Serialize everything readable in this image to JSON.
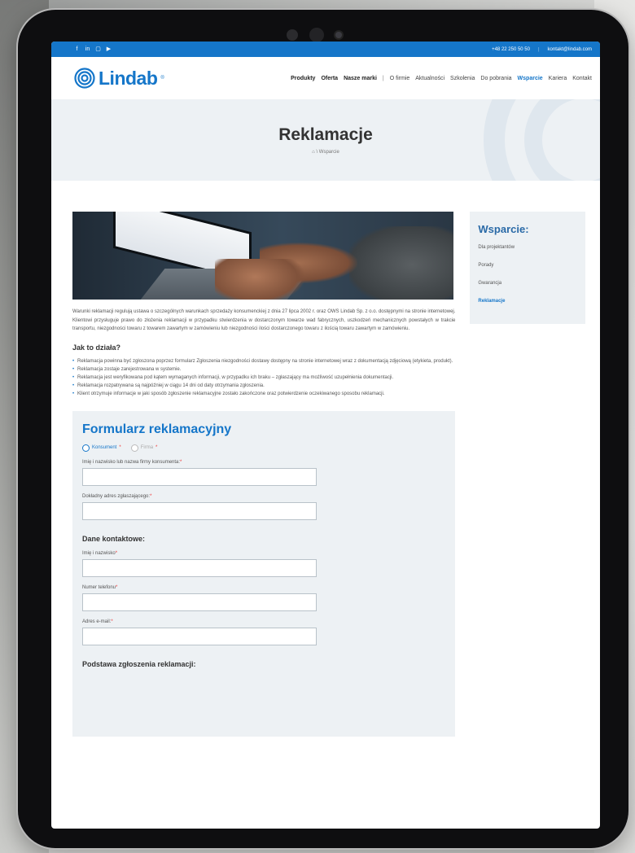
{
  "topbar": {
    "phone": "+48 22 250 50 50",
    "email": "kontakt@lindab.com",
    "social_icons": [
      "facebook-icon",
      "linkedin-icon",
      "instagram-icon",
      "youtube-icon"
    ]
  },
  "header": {
    "logo_text": "Lindab",
    "logo_reg": "®",
    "nav": [
      {
        "label": "Produkty",
        "style": "bold"
      },
      {
        "label": "Oferta",
        "style": "bold"
      },
      {
        "label": "Nasze marki",
        "style": "bold"
      },
      {
        "label": "|",
        "style": "pipe"
      },
      {
        "label": "O firmie",
        "style": "normal"
      },
      {
        "label": "Aktualności",
        "style": "normal"
      },
      {
        "label": "Szkolenia",
        "style": "normal"
      },
      {
        "label": "Do pobrania",
        "style": "normal"
      },
      {
        "label": "Wsparcie",
        "style": "active"
      },
      {
        "label": "Kariera",
        "style": "normal"
      },
      {
        "label": "Kontakt",
        "style": "normal"
      }
    ]
  },
  "hero": {
    "title": "Reklamacje",
    "breadcrumb": "⌂ \\ Wsparcie"
  },
  "main": {
    "intro": "Warunki reklamacji regulują ustawa o szczególnych warunkach sprzedaży konsumenckiej z dnia 27 lipca 2002 r. oraz OWS Lindab Sp. z o.o. dostępnymi na stronie internetowej. Klientowi przysługuje prawo do złożenia reklamacji w przypadku stwierdzenia w dostarczonym towarze wad fabrycznych, uszkodzeń mechanicznych powstałych w trakcie transportu, niezgodności towaru z towarem zawartym w zamówieniu lub niezgodności ilości dostarczonego towaru z ilością towaru zawartym w zamówieniu.",
    "how_heading": "Jak to działa?",
    "bullets": [
      "Reklamacja powinna być zgłoszona poprzez formularz Zgłoszenia niezgodności dostawy dostępny na stronie internetowej wraz z dokumentacją zdjęciową (etykieta, produkt).",
      "Reklamacja zostaje zarejestrowana w systemie.",
      "Reklamacja jest weryfikowana pod kątem wymaganych informacji, w przypadku ich braku – zgłaszający ma możliwość uzupełnienia dokumentacji.",
      "Reklamacja rozpatrywana są najpóźniej w ciągu 14 dni od daty otrzymania zgłoszenia.",
      "Klient otrzymuje informacje w jaki sposób zgłoszenie reklamacyjne zostało zakończone oraz potwierdzenie oczekiwanego sposobu reklamacji."
    ]
  },
  "form": {
    "title": "Formularz reklamacyjny",
    "radio_consumer": "Konsument",
    "radio_company": "Firma",
    "required_mark": "*",
    "label_name": "Imię i nazwisko lub nazwa firmy konsumenta:",
    "label_address": "Dokładny adres zgłaszającego:",
    "contact_heading": "Dane kontaktowe:",
    "label_person": "Imię i nazwisko",
    "label_phone": "Numer telefonu",
    "label_email": "Adres e-mail:",
    "basis_heading": "Podstawa zgłoszenia reklamacji:"
  },
  "sidebar": {
    "title": "Wsparcie:",
    "items": [
      "Dla projektantów",
      "Porady",
      "Gwarancja",
      "Reklamacje"
    ],
    "active_index": 3
  },
  "colors": {
    "brand_blue": "#1576c9",
    "panel_bg": "#edf1f4"
  }
}
